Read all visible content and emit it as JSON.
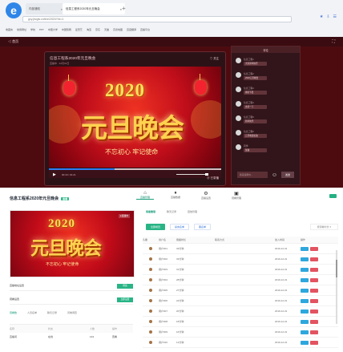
{
  "browser": {
    "tabs": [
      "内部通知",
      "信息工程系2020年元旦晚会"
    ],
    "address": "gxy.jhcgtv.cn/live/2020/?id=1",
    "bookmarks": [
      "收藏夹",
      "常用网址",
      "学校",
      "PPT",
      "中国大学",
      "中国知网",
      "爱奇艺",
      "淘宝",
      "京东",
      "天猫",
      "高德地图",
      "百度翻译",
      "直播平台"
    ]
  },
  "live": {
    "back": "◁ 首页",
    "fullscreen": "⛶",
    "player_title": "信息工程系2020年元旦晚会",
    "player_subtitle": "直播中 · 12月31日",
    "share": "♡ 关注",
    "video_year": "2020",
    "video_title": "元旦晚会",
    "video_slogan": "不忘初心 牢记使命",
    "time": "00:16 / 01:21",
    "footer": "⓪ 已录播",
    "chat_title": "评论",
    "chat_placeholder": "我来说两句...",
    "send": "发送",
    "messages": [
      {
        "name": "信息工程1",
        "text": "大家新年快乐"
      },
      {
        "name": "信息工程2",
        "text": "2020元旦晚会"
      },
      {
        "name": "信息工程3",
        "text": "期待节目"
      },
      {
        "name": "信息工程4",
        "text": "支持一下"
      },
      {
        "name": "信息工程5",
        "text": "新年快乐"
      },
      {
        "name": "信息工程6",
        "text": "元旦晚会加油"
      },
      {
        "name": "同学",
        "text": "加油"
      }
    ]
  },
  "admin": {
    "title": "信息工程系2020年元旦晚会",
    "badge": "直播",
    "nav": [
      {
        "icon": "⌂",
        "label": "直播管理"
      },
      {
        "icon": "♦",
        "label": "直播数据"
      },
      {
        "icon": "⚙",
        "label": "直播设置"
      },
      {
        "icon": "▣",
        "label": "观看管理"
      }
    ],
    "preview_badge": "●直播中",
    "settings": [
      {
        "label": "直播地址设置",
        "button": "修改"
      },
      {
        "label": "观看设置",
        "button": "立即设置"
      }
    ],
    "left_tabs": [
      "观看数",
      "人员名单",
      "聊天记录",
      "问卷调查"
    ],
    "mini_head": [
      "名称",
      "状态",
      "人数",
      "操作"
    ],
    "mini_rows": [
      [
        "直播间",
        "在线",
        "123",
        "查看"
      ]
    ],
    "subtabs": [
      "观看管理",
      "聊天记录",
      "回放管理"
    ],
    "filters": [
      "全部成员",
      "禁言名单",
      "黑名单"
    ],
    "sort": "按观看时长 ▾",
    "table_head": [
      "头像",
      "用户名",
      "观看时长",
      "联系方式",
      "加入时间",
      "操作"
    ],
    "rows": [
      [
        "",
        "用户001",
        "33分钟",
        "",
        "2019-12-31",
        ""
      ],
      [
        "",
        "用户002",
        "33分钟",
        "",
        "2019-12-31",
        ""
      ],
      [
        "",
        "用户003",
        "31分钟",
        "",
        "2019-12-31",
        ""
      ],
      [
        "",
        "用户004",
        "28分钟",
        "",
        "2019-12-31",
        ""
      ],
      [
        "",
        "用户005",
        "27分钟",
        "",
        "2019-12-31",
        ""
      ],
      [
        "",
        "用户006",
        "24分钟",
        "",
        "2019-12-31",
        ""
      ],
      [
        "",
        "用户007",
        "20分钟",
        "",
        "2019-12-31",
        ""
      ],
      [
        "",
        "用户008",
        "18分钟",
        "",
        "2019-12-31",
        ""
      ],
      [
        "",
        "用户009",
        "16分钟",
        "",
        "2019-12-31",
        ""
      ],
      [
        "",
        "用户010",
        "12分钟",
        "",
        "2019-12-31",
        ""
      ]
    ]
  }
}
